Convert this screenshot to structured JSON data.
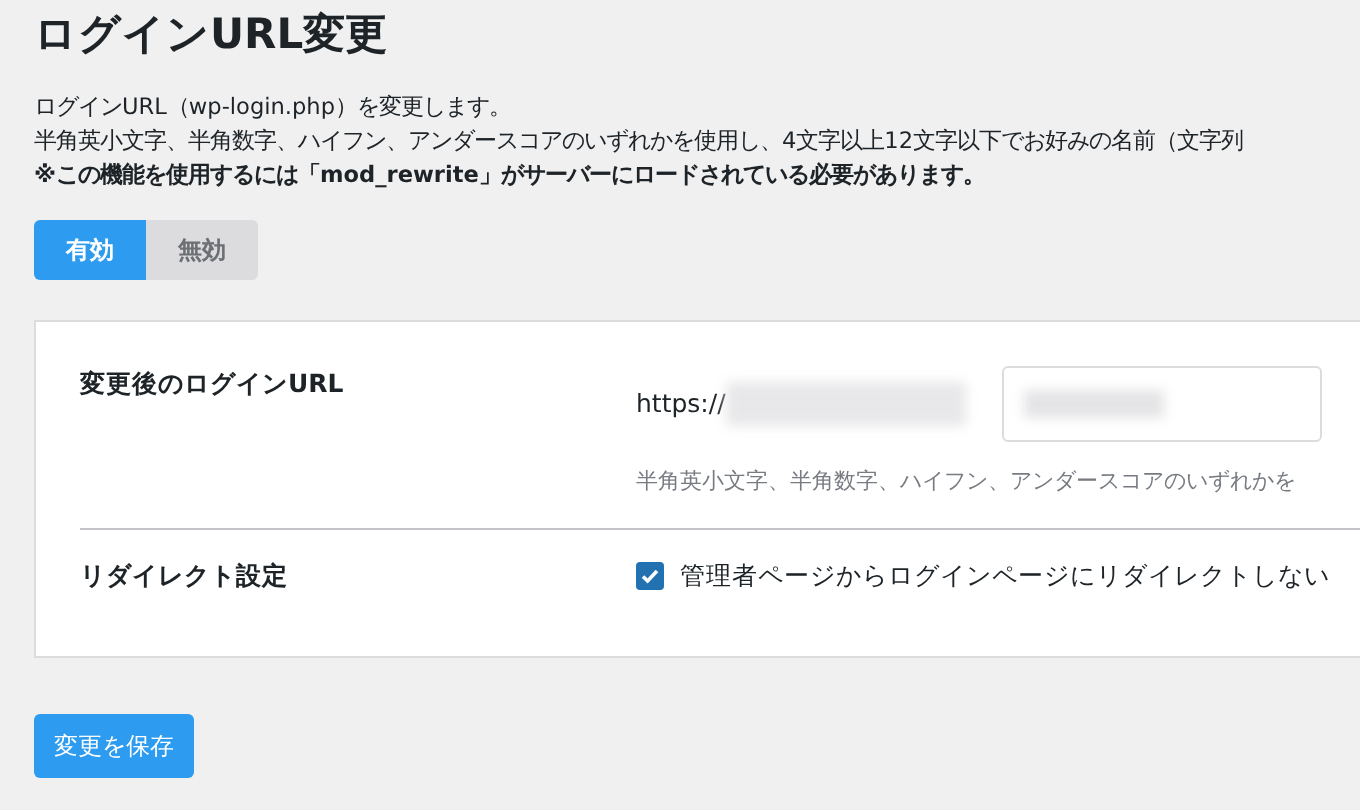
{
  "title": "ログインURL変更",
  "description": [
    "ログインURL（wp-login.php）を変更します。",
    "半角英小文字、半角数字、ハイフン、アンダースコアのいずれかを使用し、4文字以上12文字以下でお好みの名前（文字列"
  ],
  "notice": "※この機能を使用するには「mod_rewrite」がサーバーにロードされている必要があります。",
  "toggle": [
    {
      "label": "有効",
      "selected": true
    },
    {
      "label": "無効",
      "selected": false
    }
  ],
  "settings": [
    {
      "kind": "url",
      "label": "変更後のログインURL",
      "prefix": "https://",
      "hint": "半角英小文字、半角数字、ハイフン、アンダースコアのいずれかを"
    },
    {
      "kind": "checkbox",
      "label": "リダイレクト設定",
      "option": "管理者ページからログインページにリダイレクトしない",
      "checked": true
    }
  ],
  "save_button": "変更を保存"
}
